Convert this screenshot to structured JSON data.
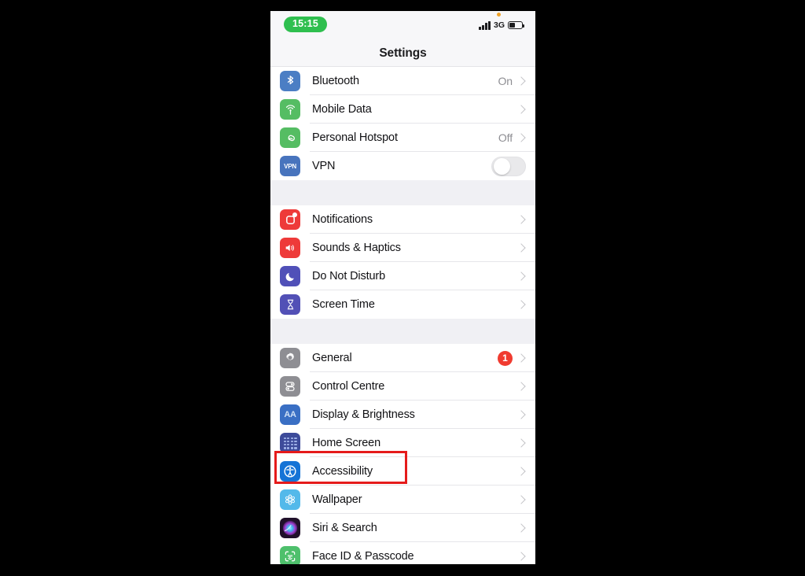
{
  "status_bar": {
    "time": "15:15",
    "network": "3G",
    "recording_indicator": "orange-dot",
    "battery_icon": "battery-icon",
    "signal_icon": "cellular-bars-icon"
  },
  "nav": {
    "title": "Settings"
  },
  "colors": {
    "accent_blue": "#1573d6",
    "badge_red": "#f03b30",
    "time_pill_green": "#2fbf4f",
    "annotation_red": "#e51b1b",
    "separator": "#e6e6ea",
    "group_gap": "#f0f0f4"
  },
  "groups": [
    {
      "rows": [
        {
          "label": "Bluetooth",
          "value": "On",
          "accessory": "chevron",
          "icon": "bluetooth-icon"
        },
        {
          "label": "Mobile Data",
          "value": "",
          "accessory": "chevron",
          "icon": "cellular-icon"
        },
        {
          "label": "Personal Hotspot",
          "value": "Off",
          "accessory": "chevron",
          "icon": "hotspot-icon"
        },
        {
          "label": "VPN",
          "value": "",
          "accessory": "toggle",
          "icon": "vpn-icon",
          "toggle_state": "off",
          "icon_text": "VPN"
        }
      ]
    },
    {
      "rows": [
        {
          "label": "Notifications",
          "value": "",
          "accessory": "chevron",
          "icon": "notifications-icon"
        },
        {
          "label": "Sounds & Haptics",
          "value": "",
          "accessory": "chevron",
          "icon": "sounds-icon"
        },
        {
          "label": "Do Not Disturb",
          "value": "",
          "accessory": "chevron",
          "icon": "moon-icon"
        },
        {
          "label": "Screen Time",
          "value": "",
          "accessory": "chevron",
          "icon": "hourglass-icon"
        }
      ]
    },
    {
      "rows": [
        {
          "label": "General",
          "value": "",
          "accessory": "chevron",
          "icon": "gear-icon",
          "badge": "1"
        },
        {
          "label": "Control Centre",
          "value": "",
          "accessory": "chevron",
          "icon": "sliders-icon"
        },
        {
          "label": "Display & Brightness",
          "value": "",
          "accessory": "chevron",
          "icon": "display-icon",
          "icon_text": "AA"
        },
        {
          "label": "Home Screen",
          "value": "",
          "accessory": "chevron",
          "icon": "home-screen-icon"
        },
        {
          "label": "Accessibility",
          "value": "",
          "accessory": "chevron",
          "icon": "accessibility-icon",
          "highlighted": true
        },
        {
          "label": "Wallpaper",
          "value": "",
          "accessory": "chevron",
          "icon": "wallpaper-icon"
        },
        {
          "label": "Siri & Search",
          "value": "",
          "accessory": "chevron",
          "icon": "siri-icon"
        },
        {
          "label": "Face ID & Passcode",
          "value": "",
          "accessory": "chevron",
          "icon": "face-id-icon"
        }
      ]
    }
  ],
  "annotation": {
    "target": "Accessibility",
    "shape": "rectangle",
    "color": "#e51b1b"
  }
}
